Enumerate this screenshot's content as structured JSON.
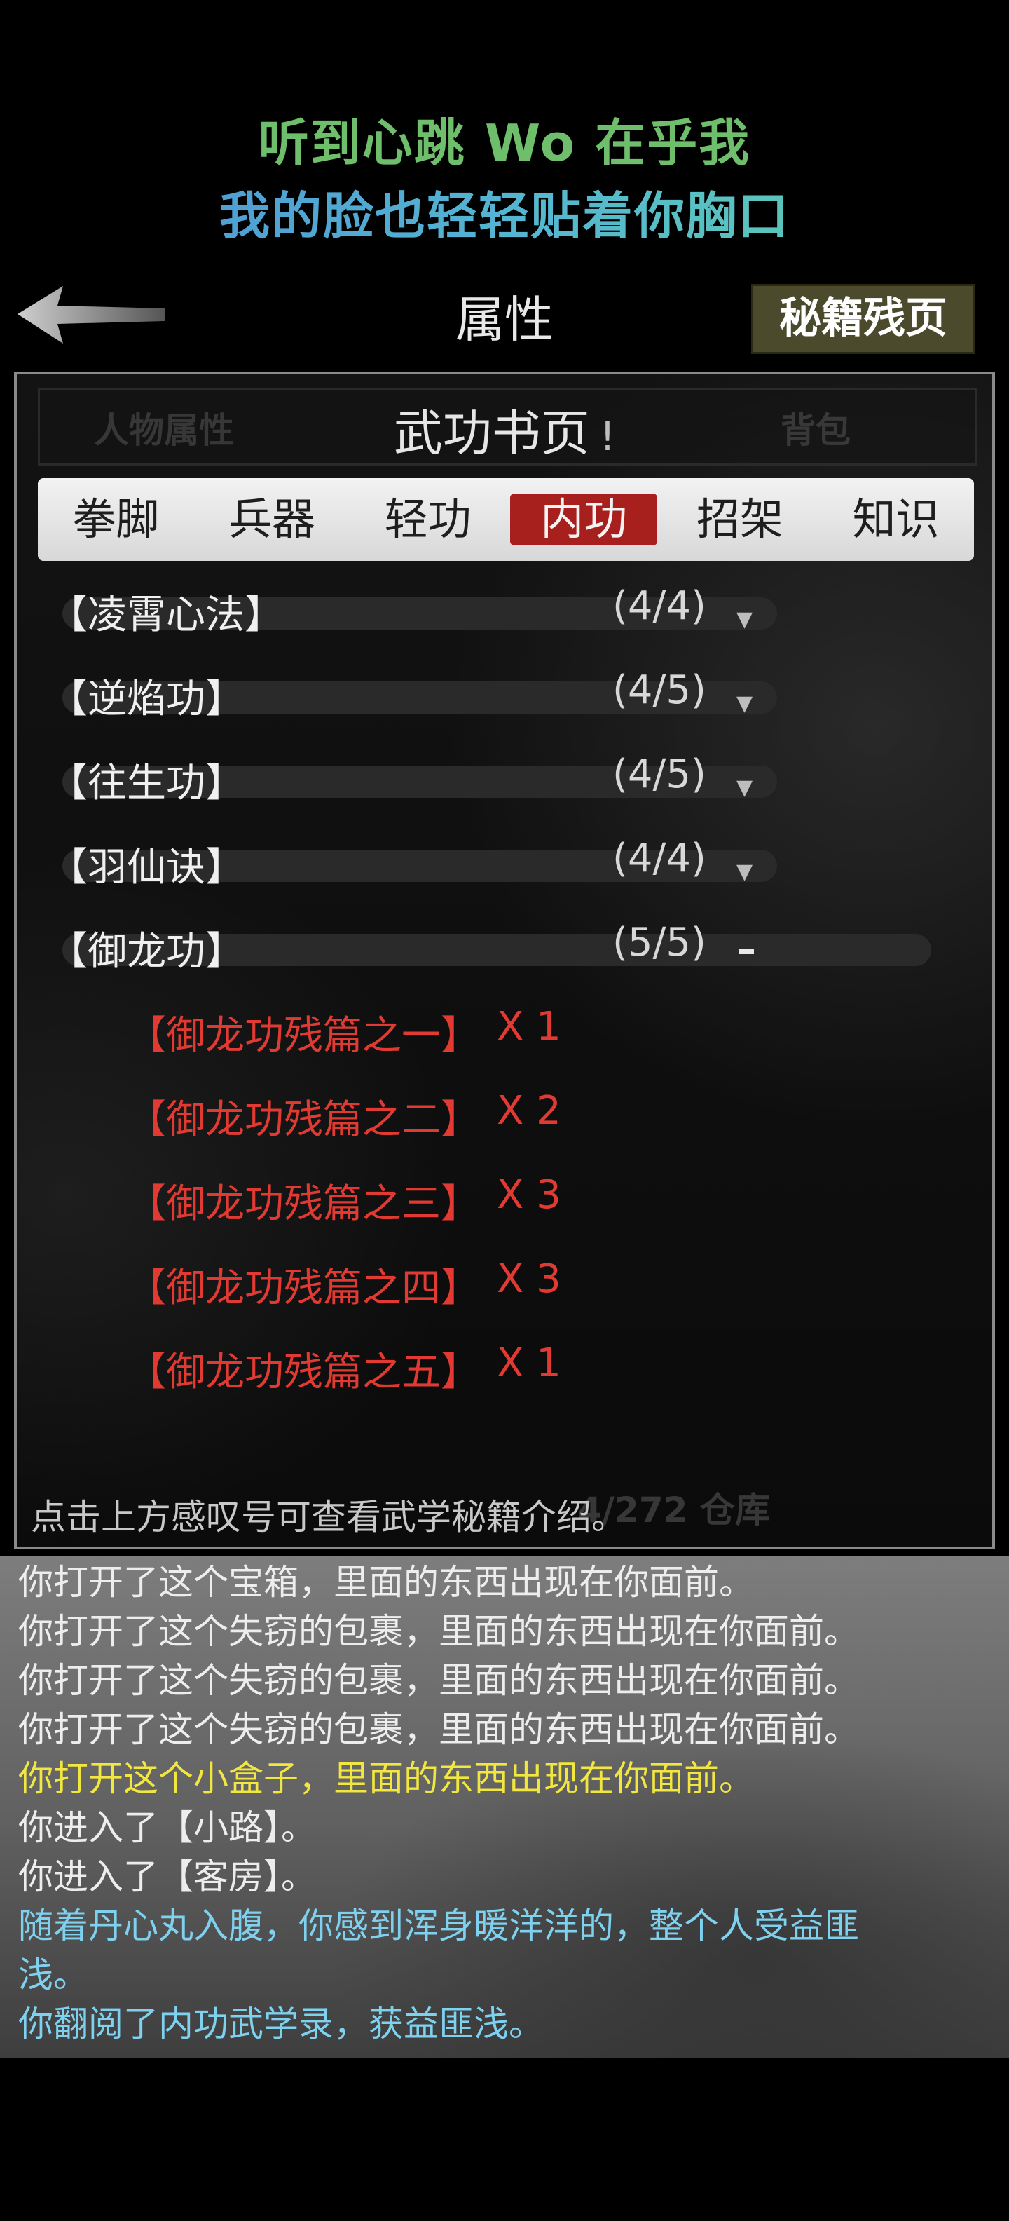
{
  "lyrics": {
    "line1": "听到心跳 Wo 在乎我",
    "line2": "我的脸也轻轻贴着你胸口"
  },
  "header": {
    "title": "属性",
    "secret_button": "秘籍残页"
  },
  "panel": {
    "ghost_left": "人物属性",
    "ghost_right": "背包",
    "ghost_bottom": "4/272 仓库",
    "title": "武功书页",
    "info_mark": "!",
    "tabs": [
      "拳脚",
      "兵器",
      "轻功",
      "内功",
      "招架",
      "知识"
    ],
    "active_tab": "内功",
    "skills": [
      {
        "name": "【凌霄心法】",
        "count": "(4/4)"
      },
      {
        "name": "【逆焰功】",
        "count": "(4/5)"
      },
      {
        "name": "【往生功】",
        "count": "(4/5)"
      },
      {
        "name": "【羽仙诀】",
        "count": "(4/4)"
      },
      {
        "name": "【御龙功】",
        "count": "(5/5)"
      }
    ],
    "fragments": [
      {
        "name": "【御龙功残篇之一】",
        "qty": "X 1"
      },
      {
        "name": "【御龙功残篇之二】",
        "qty": "X 2"
      },
      {
        "name": "【御龙功残篇之三】",
        "qty": "X 3"
      },
      {
        "name": "【御龙功残篇之四】",
        "qty": "X 3"
      },
      {
        "name": "【御龙功残篇之五】",
        "qty": "X 1"
      }
    ],
    "hint": "点击上方感叹号可查看武学秘籍介绍。"
  },
  "log": [
    {
      "text": "你打开了这个宝箱，里面的东西出现在你面前。",
      "color": "#ededed"
    },
    {
      "text": "你打开了这个失窃的包裹，里面的东西出现在你面前。",
      "color": "#ededed"
    },
    {
      "text": "你打开了这个失窃的包裹，里面的东西出现在你面前。",
      "color": "#ededed"
    },
    {
      "text": "你打开了这个失窃的包裹，里面的东西出现在你面前。",
      "color": "#ededed"
    },
    {
      "text": "你打开这个小盒子，里面的东西出现在你面前。",
      "color": "#f2e640"
    },
    {
      "text": "你进入了【小路】。",
      "color": "#ededed"
    },
    {
      "text": "你进入了【客房】。",
      "color": "#ededed"
    },
    {
      "text": "随着丹心丸入腹，你感到浑身暖洋洋的，整个人受益匪",
      "color": "#7fd1f0"
    },
    {
      "text": "浅。",
      "color": "#7fd1f0"
    },
    {
      "text": "你翻阅了内功武学录，获益匪浅。",
      "color": "#7fd1f0"
    }
  ]
}
